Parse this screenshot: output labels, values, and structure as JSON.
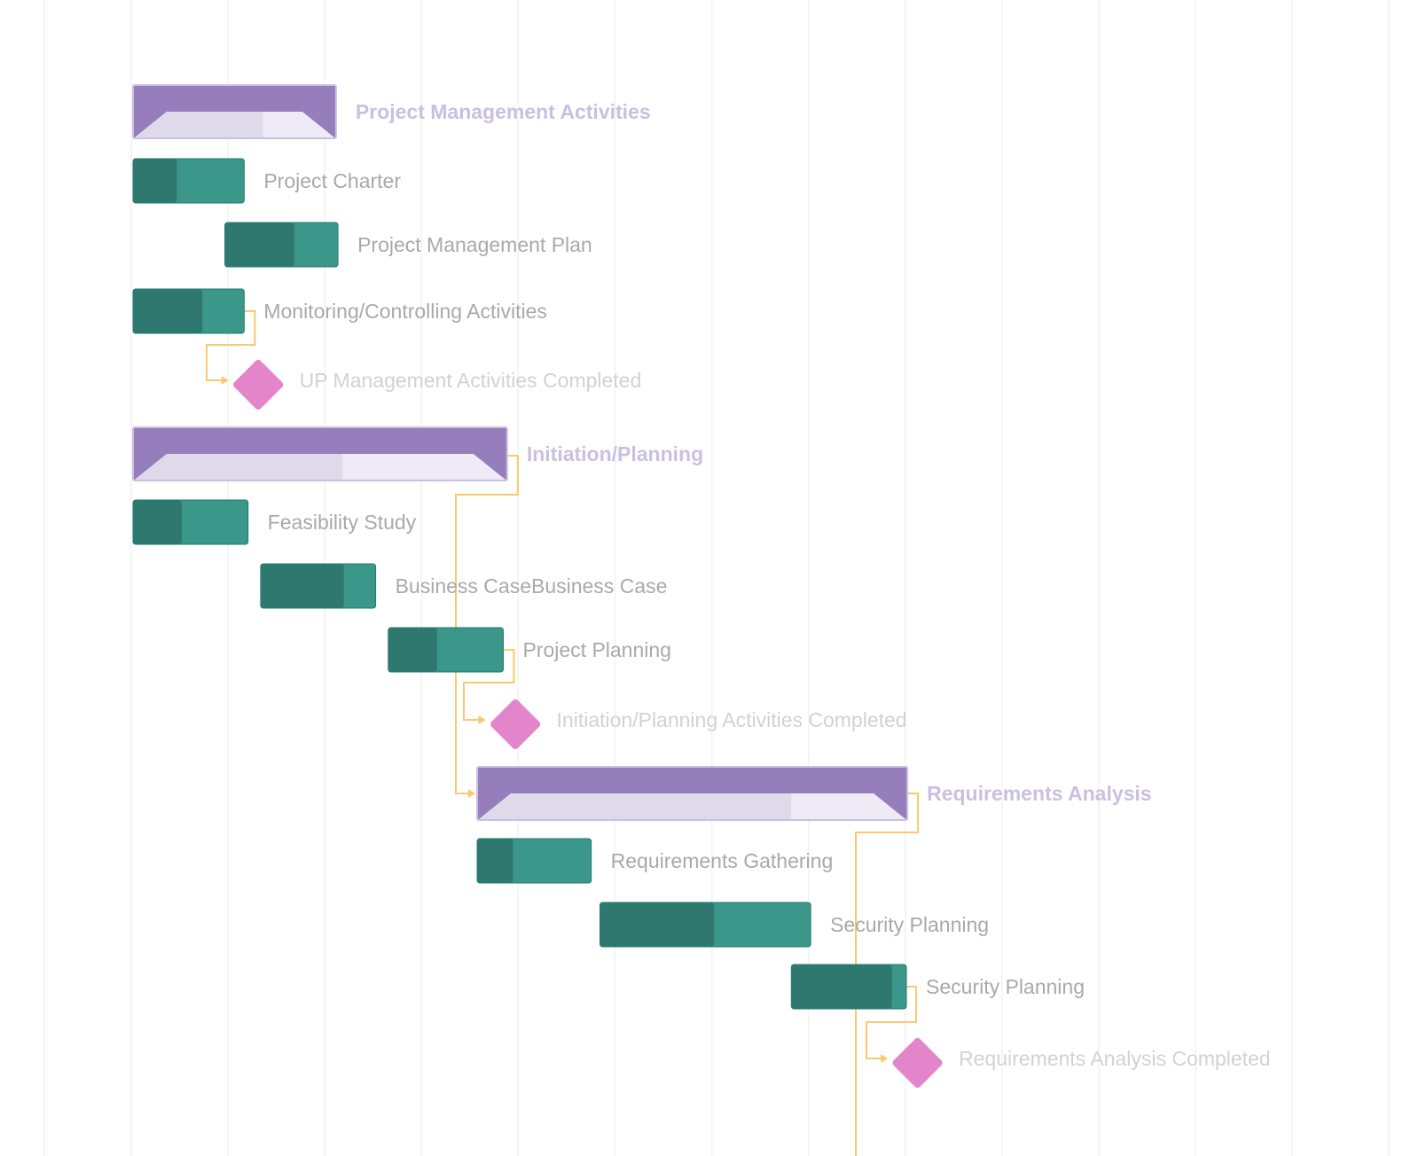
{
  "chart_data": {
    "type": "gantt",
    "title": "",
    "time_unit": "column",
    "columns_visible": 15,
    "colors": {
      "summary_bar": "#957ebb",
      "summary_progress": "#dedaea",
      "summary_remaining": "#eeebf6",
      "task_progress": "#2e7870",
      "task_remaining": "#3a978a",
      "task_border": "#1f7d70",
      "milestone": "#e285cb",
      "connector": "#fbc86c",
      "grid": "#f2f2f2",
      "task_label": "#a9a9a9",
      "summary_label": "#cbbfe0",
      "milestone_label": "#d2d2d2"
    },
    "tasks": [
      {
        "id": "pm",
        "name": "Project Management Activities",
        "type": "summary",
        "start": 0.0,
        "duration": 2.1,
        "progress": 0.64
      },
      {
        "id": "charter",
        "name": "Project Charter",
        "type": "task",
        "start": 0.0,
        "duration": 1.15,
        "progress": 0.39
      },
      {
        "id": "pmplan",
        "name": "Project Management Plan",
        "type": "task",
        "start": 0.95,
        "duration": 1.17,
        "progress": 0.61
      },
      {
        "id": "monitor",
        "name": "Monitoring/Controlling Activities",
        "type": "task",
        "start": 0.0,
        "duration": 1.15,
        "progress": 0.62
      },
      {
        "id": "upm",
        "name": "UP Management Activities Completed",
        "type": "milestone",
        "start": 1.18
      },
      {
        "id": "ip",
        "name": "Initiation/Planning",
        "type": "summary",
        "start": 0.0,
        "duration": 3.87,
        "progress": 0.56
      },
      {
        "id": "feas",
        "name": "Feasibility Study",
        "type": "task",
        "start": 0.0,
        "duration": 1.19,
        "progress": 0.42
      },
      {
        "id": "bcase",
        "name": "Business CaseBusiness Case",
        "type": "task",
        "start": 1.32,
        "duration": 1.19,
        "progress": 0.72
      },
      {
        "id": "pplan",
        "name": "Project Planning",
        "type": "task",
        "start": 2.64,
        "duration": 1.19,
        "progress": 0.42
      },
      {
        "id": "ipm",
        "name": "Initiation/Planning Activities Completed",
        "type": "milestone",
        "start": 3.84
      },
      {
        "id": "ra",
        "name": "Requirements Analysis",
        "type": "summary",
        "start": 3.56,
        "duration": 4.45,
        "progress": 0.73
      },
      {
        "id": "rg",
        "name": "Requirements Gathering",
        "type": "task",
        "start": 3.56,
        "duration": 1.18,
        "progress": 0.31
      },
      {
        "id": "sp1",
        "name": "Security Planning",
        "type": "task",
        "start": 4.83,
        "duration": 2.18,
        "progress": 0.54
      },
      {
        "id": "sp2",
        "name": "Security Planning",
        "type": "task",
        "start": 6.81,
        "duration": 1.19,
        "progress": 0.87
      },
      {
        "id": "ram",
        "name": "Requirements Analysis Completed",
        "type": "milestone",
        "start": 8.0
      }
    ],
    "dependencies": [
      {
        "from": "monitor",
        "to": "upm"
      },
      {
        "from": "ip",
        "to": "ra"
      },
      {
        "from": "pplan",
        "to": "ipm"
      },
      {
        "from": "ra",
        "to": "next"
      },
      {
        "from": "sp2",
        "to": "ram"
      }
    ]
  }
}
